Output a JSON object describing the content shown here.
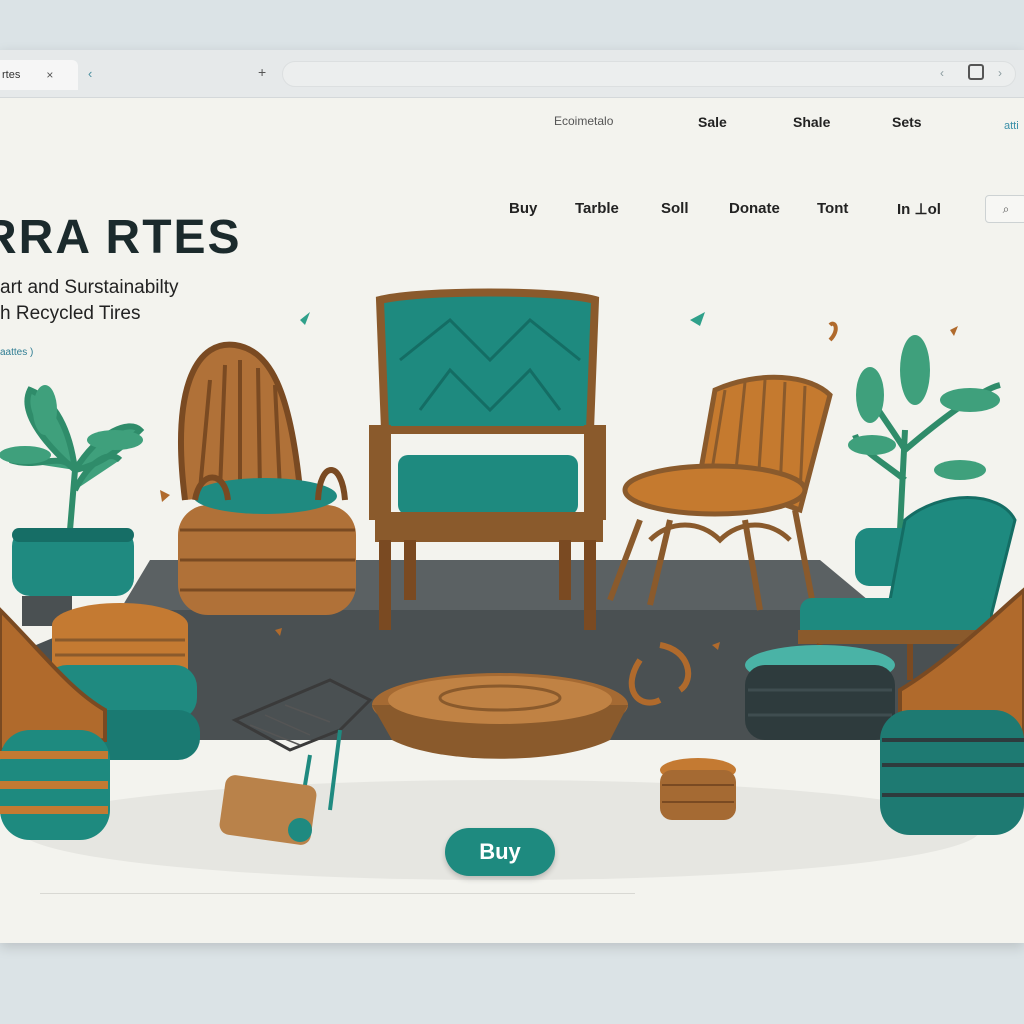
{
  "browser": {
    "tab_title": "rtes",
    "tab_close": "×",
    "nav_back": "‹",
    "new_tab": "+",
    "addr_back": "‹",
    "addr_forward": "›"
  },
  "top_nav": [
    "Ecoimetalo",
    "Sale",
    "Shale",
    "Sets"
  ],
  "top_nav_edge": "atti",
  "main_nav": [
    "Buy",
    "Tarble",
    "Soll",
    "Donate",
    "Tont",
    "In ⊥ol"
  ],
  "search_label": "⌕",
  "hero": {
    "brand": "RRA RTES",
    "tagline_line1": "art and Surstainabilty",
    "tagline_line2": "h Recycled Tires",
    "link": "aattes )"
  },
  "cta": {
    "label": "Buy"
  },
  "colors": {
    "teal": "#1e8a7f",
    "wood": "#a56a33",
    "tire": "#2e3b3d",
    "platform": "#4a5052",
    "leaf": "#2f8c6a"
  }
}
